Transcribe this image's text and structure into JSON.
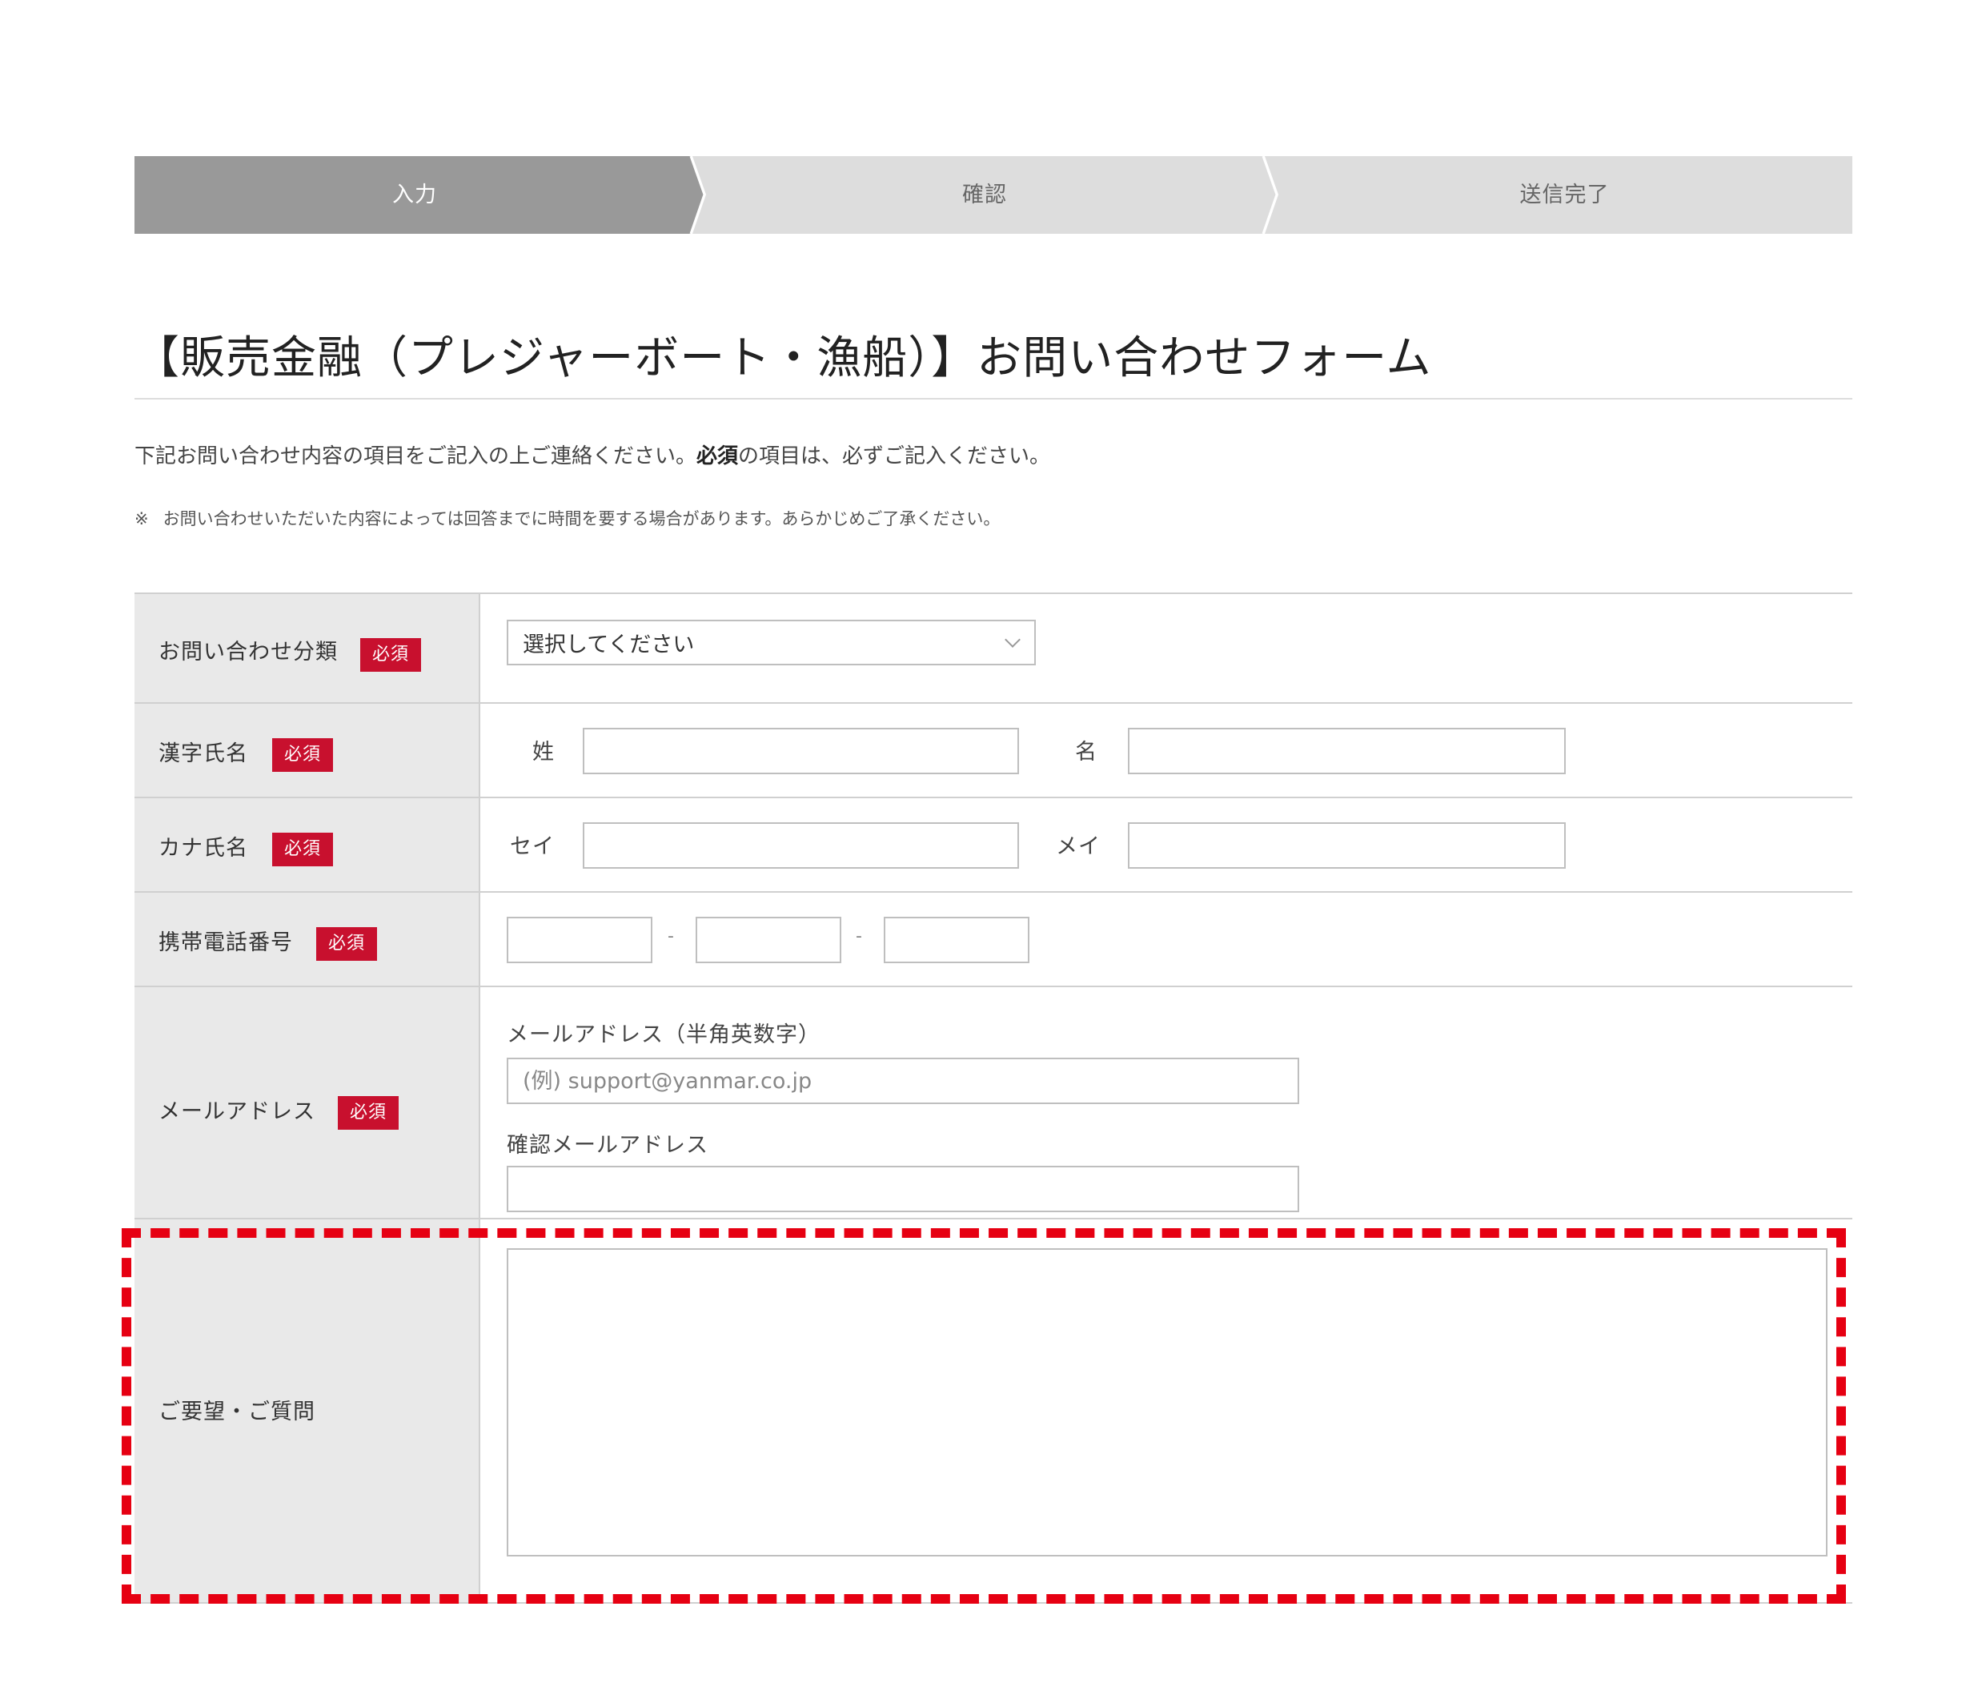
{
  "steps": {
    "items": [
      {
        "label": "入力",
        "state": "active"
      },
      {
        "label": "確認",
        "state": "inactive"
      },
      {
        "label": "送信完了",
        "state": "inactive"
      }
    ]
  },
  "heading": {
    "title": "【販売金融（プレジャーボート・漁船）】お問い合わせフォーム",
    "intro_before": "下記お問い合わせ内容の項目をご記入の上ご連絡ください。",
    "intro_bold": "必須",
    "intro_after": "の項目は、必ずご記入ください。",
    "note_mark": "※",
    "note_text": "お問い合わせいただいた内容によっては回答までに時間を要する場合があります。あらかじめご了承ください。"
  },
  "required_badge": "必須",
  "form": {
    "category": {
      "label": "お問い合わせ分類",
      "select_value": "選択してください"
    },
    "kanji_name": {
      "label": "漢字氏名",
      "last_label": "姓",
      "first_label": "名"
    },
    "kana_name": {
      "label": "カナ氏名",
      "last_label": "セイ",
      "first_label": "メイ"
    },
    "mobile": {
      "label": "携帯電話番号",
      "separator": "-"
    },
    "email": {
      "label": "メールアドレス",
      "field_label": "メールアドレス（半角英数字）",
      "placeholder": "(例) support@yanmar.co.jp",
      "confirm_label": "確認メールアドレス"
    },
    "request": {
      "label": "ご要望・ご質問"
    }
  },
  "colors": {
    "step_active": "#999999",
    "step_inactive": "#dddddd",
    "required_badge": "#c8102e",
    "highlight_border": "#e60012",
    "label_cell_bg": "#e9e9e9"
  }
}
